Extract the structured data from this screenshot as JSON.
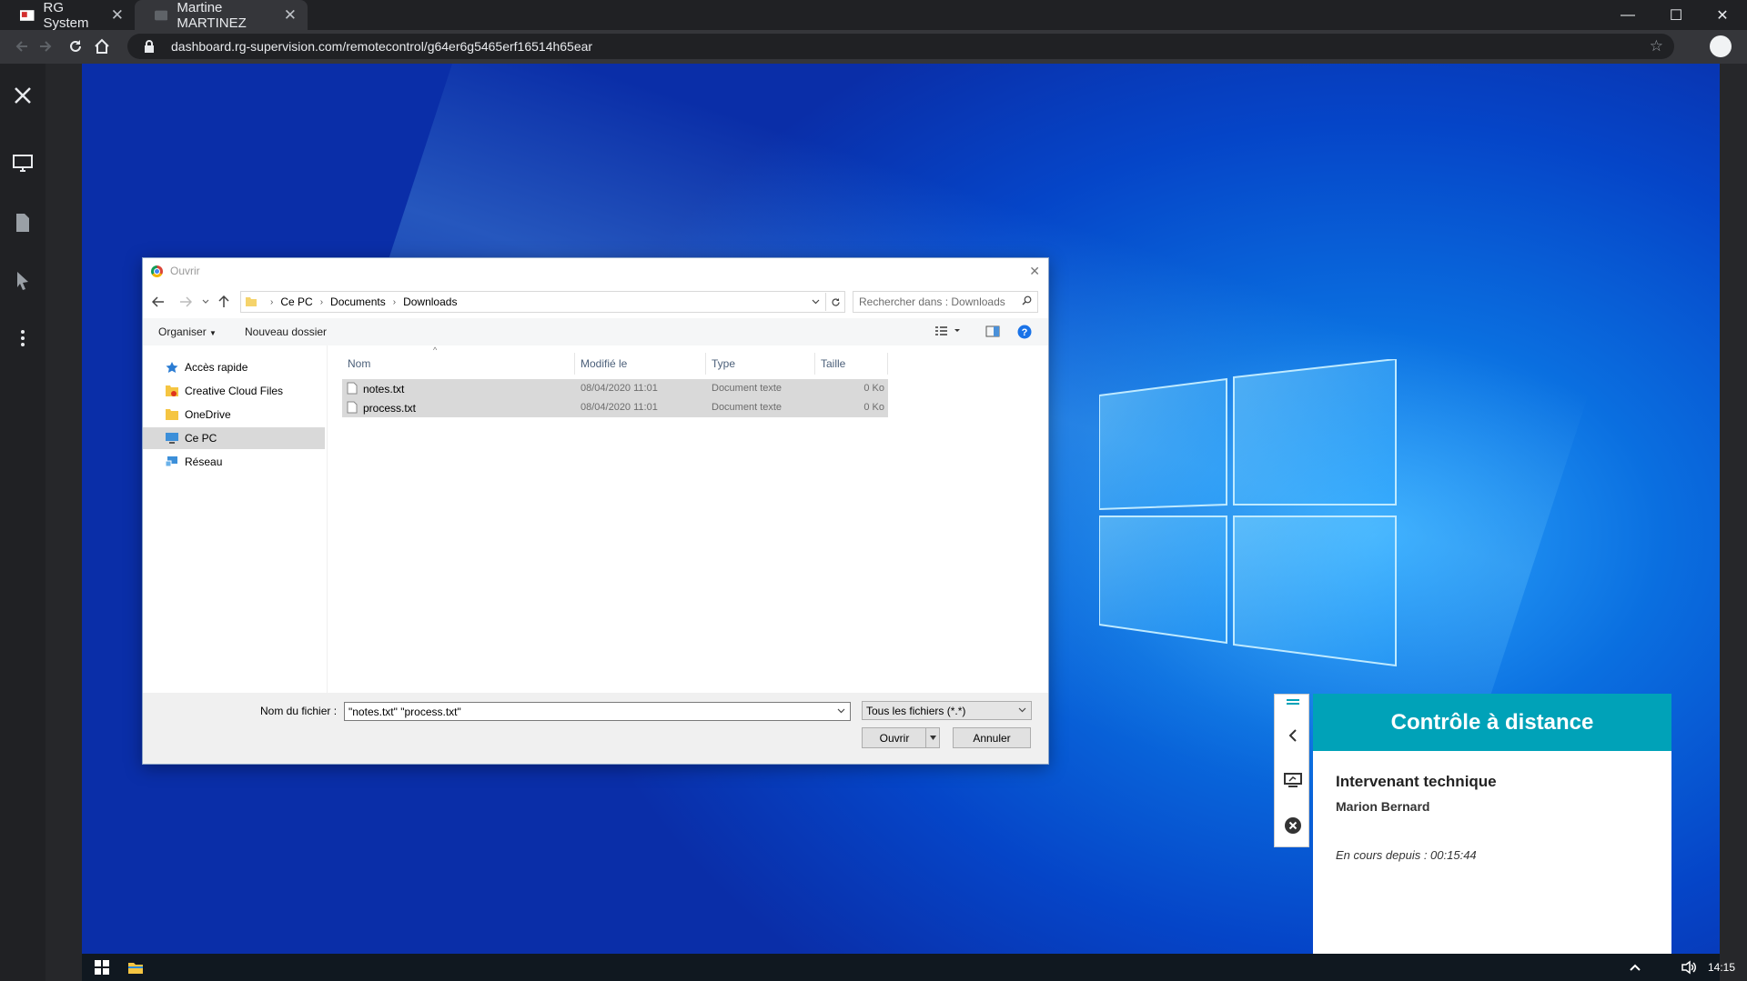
{
  "browser": {
    "tabs": [
      {
        "title": "RG System"
      },
      {
        "title": "Martine MARTINEZ"
      }
    ],
    "url": "dashboard.rg-supervision.com/remotecontrol/g64er6g5465erf16514h65ear"
  },
  "dialog": {
    "title": "Ouvrir",
    "breadcrumb": [
      "Ce PC",
      "Documents",
      "Downloads"
    ],
    "search_placeholder": "Rechercher dans : Downloads",
    "organize_label": "Organiser",
    "new_folder_label": "Nouveau dossier",
    "nav_items": [
      {
        "label": "Accès rapide",
        "icon": "star-icon"
      },
      {
        "label": "Creative Cloud Files",
        "icon": "creative-cloud-folder-icon"
      },
      {
        "label": "OneDrive",
        "icon": "folder-icon"
      },
      {
        "label": "Ce PC",
        "icon": "computer-icon",
        "selected": true
      },
      {
        "label": "Réseau",
        "icon": "network-icon"
      }
    ],
    "columns": [
      "Nom",
      "Modifié le",
      "Type",
      "Taille"
    ],
    "files": [
      {
        "name": "notes.txt",
        "modified": "08/04/2020 11:01",
        "type": "Document texte",
        "size": "0 Ko"
      },
      {
        "name": "process.txt",
        "modified": "08/04/2020 11:01",
        "type": "Document texte",
        "size": "0 Ko"
      }
    ],
    "filename_label": "Nom du fichier :",
    "filename_value": "\"notes.txt\" \"process.txt\"",
    "filter_value": "Tous les fichiers (*.*)",
    "open_label": "Ouvrir",
    "cancel_label": "Annuler"
  },
  "remote_panel": {
    "title": "Contrôle à distance",
    "role": "Intervenant technique",
    "technician": "Marion Bernard",
    "since": "En cours depuis : 00:15:44",
    "accent_color": "#00a2b8"
  },
  "taskbar": {
    "time": "14:15"
  }
}
